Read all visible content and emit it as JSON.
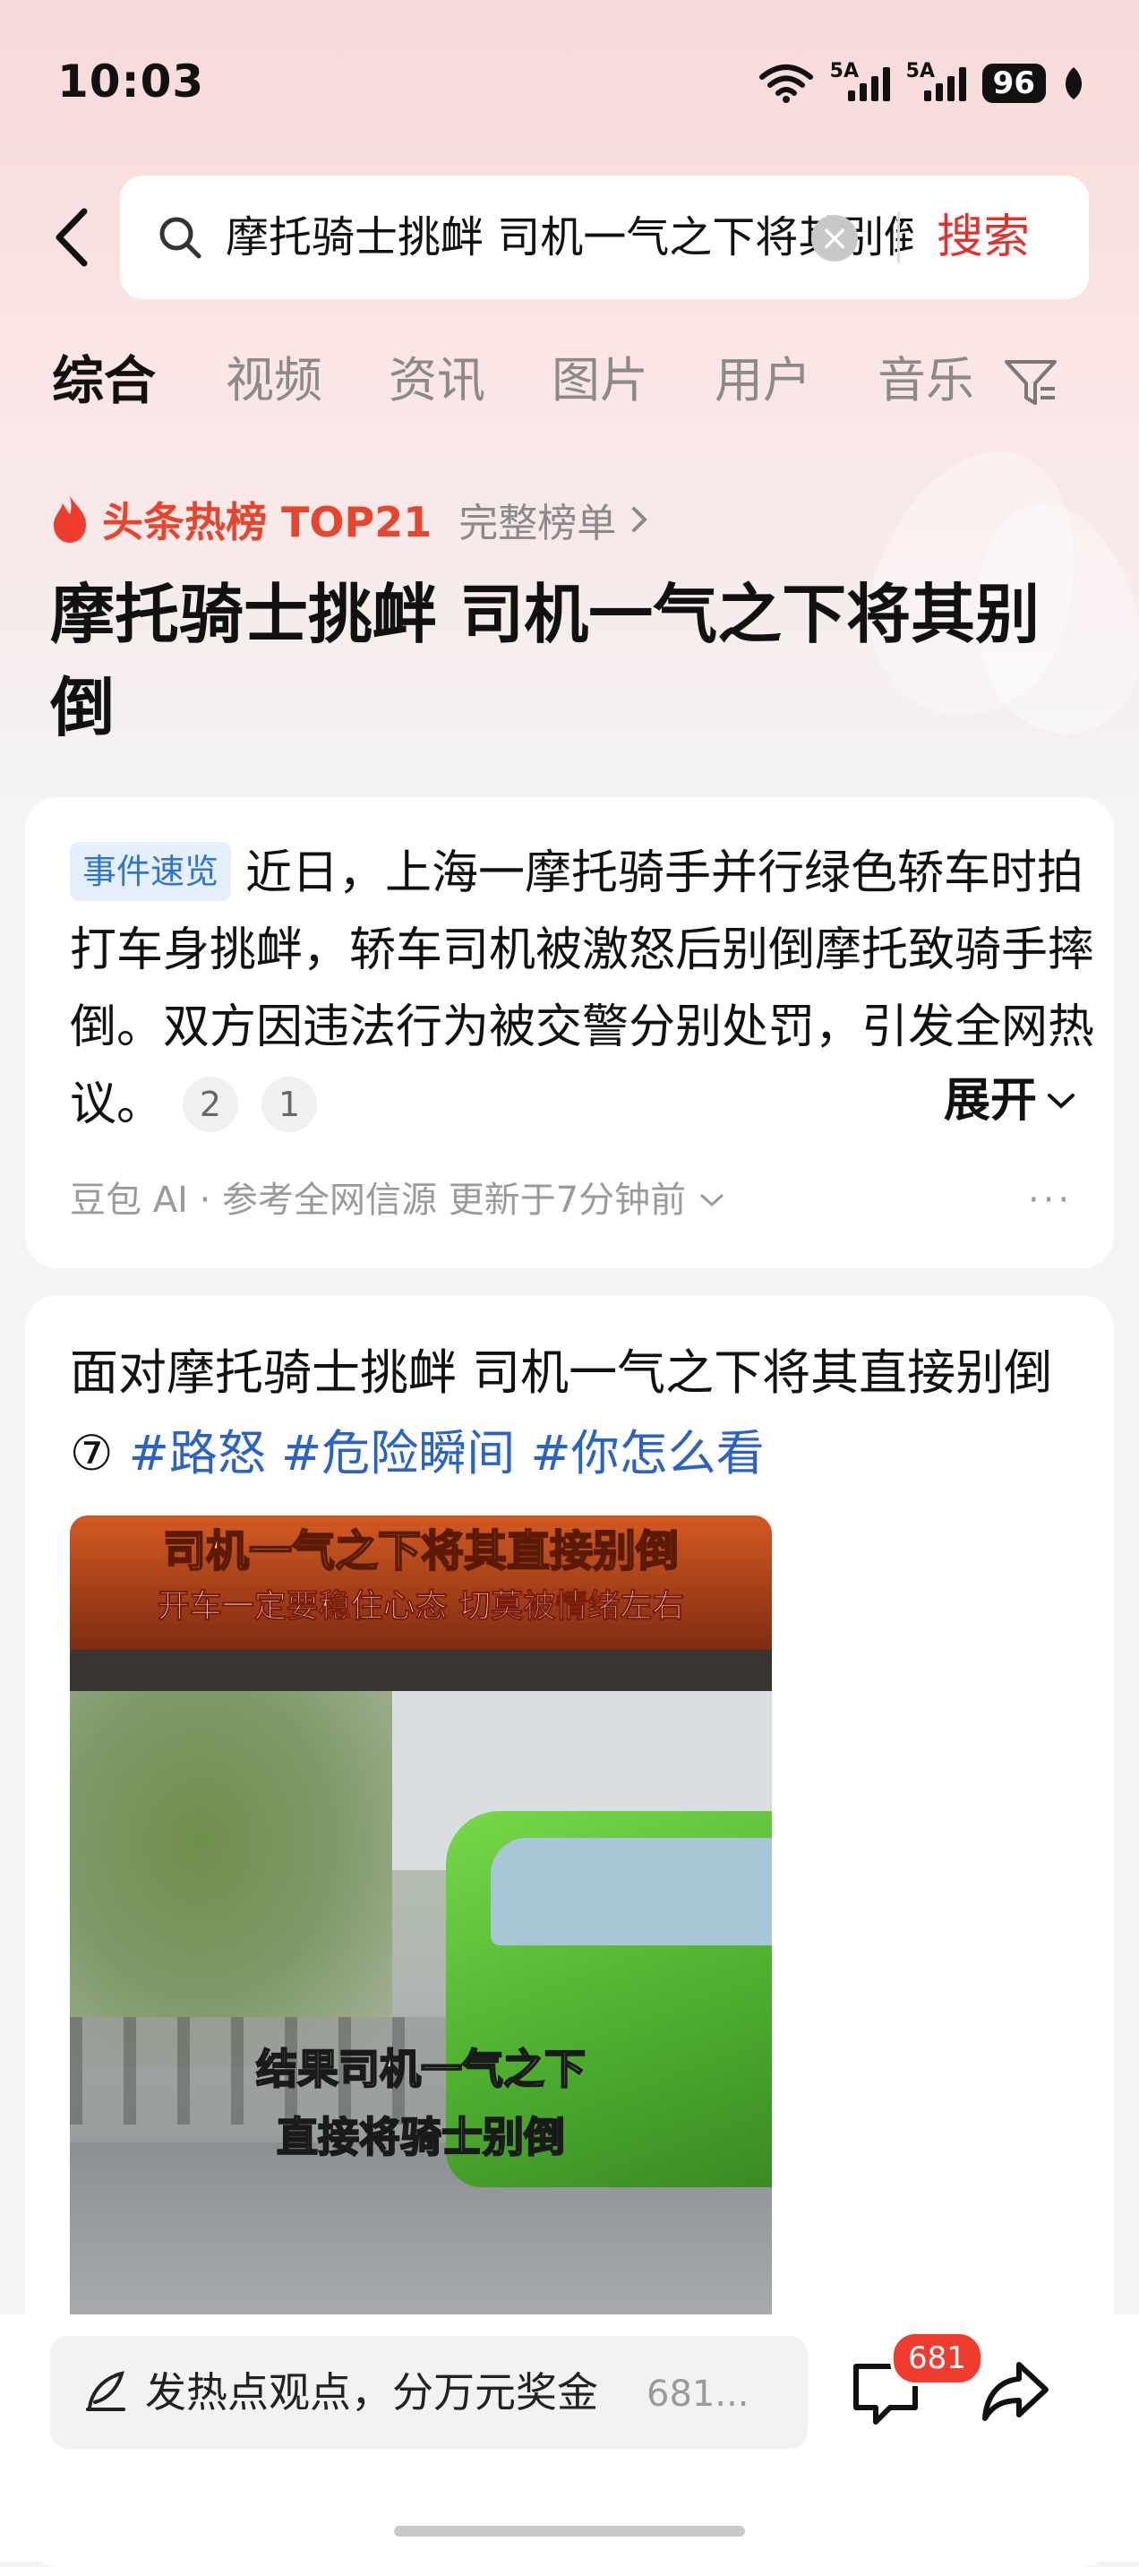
{
  "status_bar": {
    "time": "10:03",
    "signal1": "5A",
    "signal2": "5A",
    "battery": "96"
  },
  "search": {
    "query": "摩托骑士挑衅 司机一气之下将其别倒",
    "clear_icon": "clear-icon",
    "submit_label": "搜索"
  },
  "tabs": [
    {
      "label": "综合",
      "active": true
    },
    {
      "label": "视频",
      "active": false
    },
    {
      "label": "资讯",
      "active": false
    },
    {
      "label": "图片",
      "active": false
    },
    {
      "label": "用户",
      "active": false
    },
    {
      "label": "音乐",
      "active": false
    }
  ],
  "hot": {
    "label": "头条热榜 TOP21",
    "full_list": "完整榜单"
  },
  "headline": "摩托骑士挑衅 司机一气之下将其别倒",
  "summary_card": {
    "badge": "事件速览",
    "text": "近日，上海一摩托骑手并行绿色轿车时拍打车身挑衅，轿车司机被激怒后别倒摩托致骑手摔倒。双方因违法行为被交警分别处罚，引发全网热议。",
    "citations": [
      "2",
      "1"
    ],
    "expand_label": "展开",
    "source": "豆包 AI · 参考全网信源 更新于7分钟前",
    "more": "···"
  },
  "post_card": {
    "title": "面对摩托骑士挑衅 司机一气之下将其直接别倒⑦ ",
    "hashtags": [
      "#路怒",
      "#危险瞬间",
      "#你怎么看"
    ],
    "video_banner_line1": "司机一气之下将其直接别倒",
    "video_banner_line2": "开车一定要稳住心态 切莫被情绪左右",
    "video_caption_line1": "结果司机一气之下",
    "video_caption_line2": "直接将骑士别倒"
  },
  "bottom_bar": {
    "comment_placeholder": "发热点观点，分万元奖金",
    "comment_count_inline": "681...",
    "comment_badge": "681"
  },
  "colors": {
    "accent_red": "#e0332f",
    "hashtag_blue": "#2b63c4",
    "badge_blue_bg": "#e6f0fc",
    "hot_orange": "#e8452e"
  }
}
